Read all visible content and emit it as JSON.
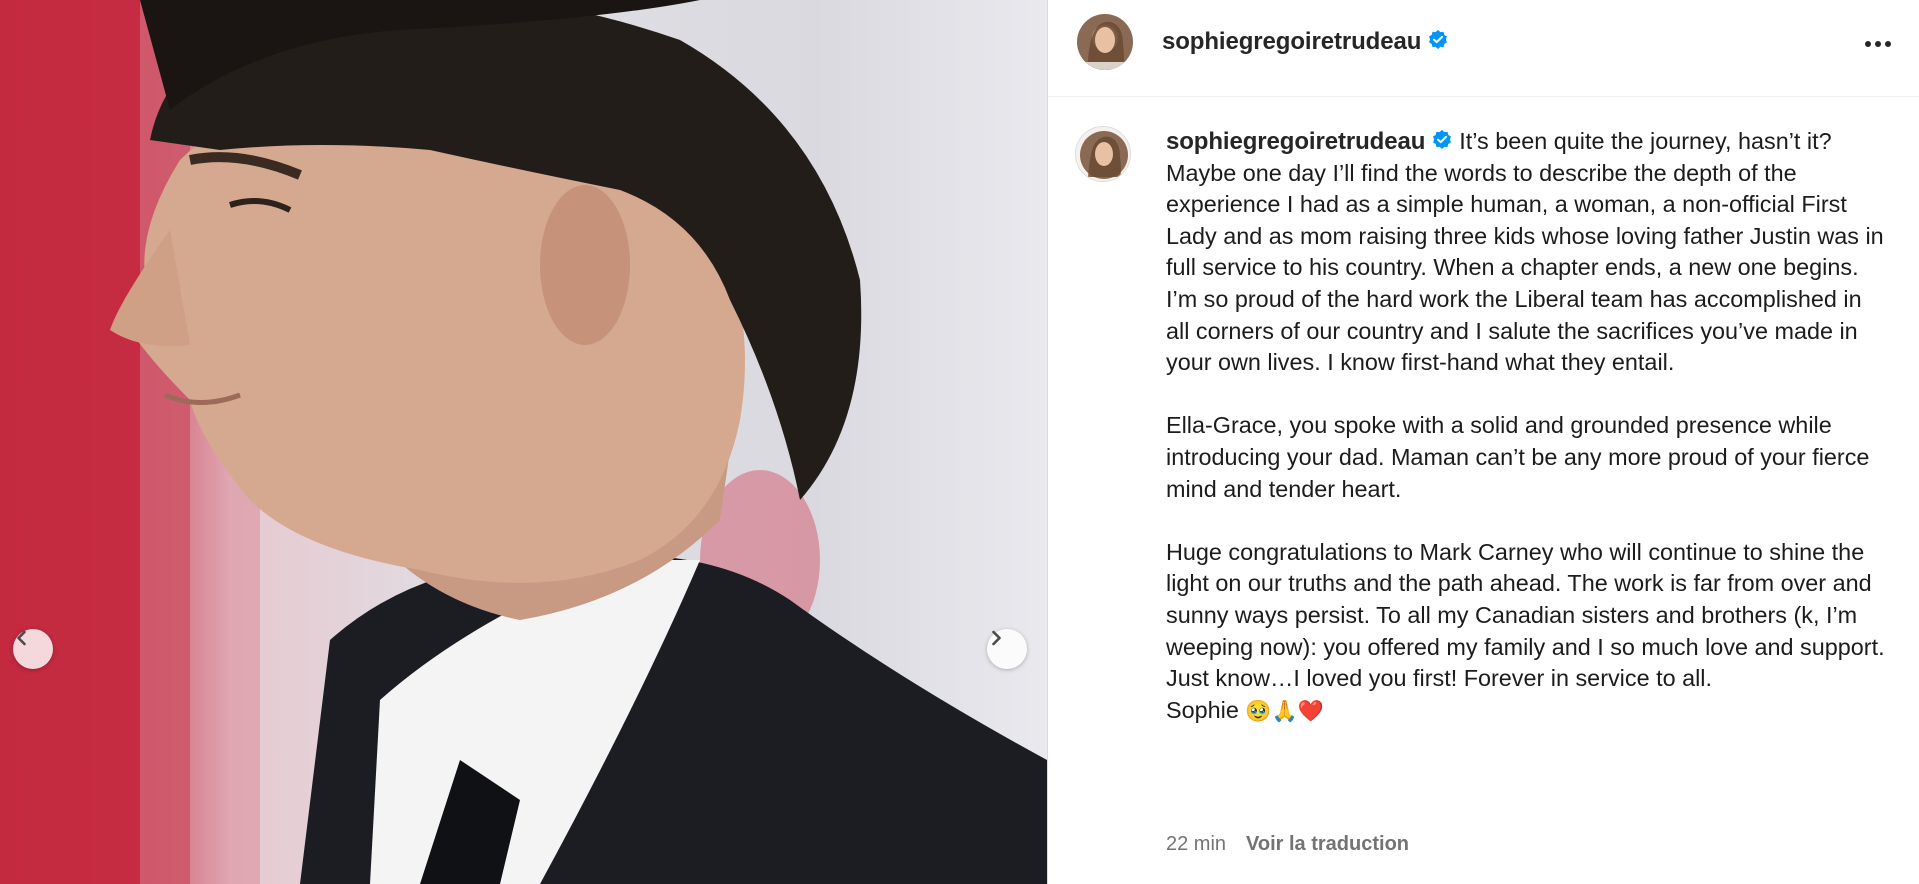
{
  "post": {
    "username": "sophiegregoiretrudeau",
    "verified": true,
    "caption": {
      "first_line": "It’s been quite the journey, hasn’t it?",
      "paragraph1": "Maybe one day I’ll find the words to describe the depth of the experience I had as a simple human, a woman, a non-official First Lady and as mom raising three kids whose loving father Justin was in full service to his country. When a chapter ends, a new one begins. I’m so proud of the hard work the Liberal team has accomplished in all corners of our country and I salute the sacrifices you’ve made in your own lives. I know first-hand what they entail.",
      "paragraph2": "Ella-Grace, you spoke with a solid and grounded presence while introducing your dad. Maman can’t be any more proud of your fierce mind and tender heart.",
      "paragraph3": "Huge congratulations to Mark Carney who will continue to shine the light on our truths and the path ahead. The work is far from over and sunny ways persist. To all my Canadian sisters and brothers (k, I’m weeping now): you offered my family and I so much love and support. Just know…I loved you first! Forever in service to all.",
      "signature": "Sophie",
      "signature_emoji": "🥹🙏❤️"
    },
    "timestamp": "22 min",
    "translate_label": "Voir la traduction"
  },
  "icons": {
    "verified": "verified-badge-icon",
    "more": "more-options-icon",
    "prev": "chevron-left-icon",
    "next": "chevron-right-icon"
  },
  "colors": {
    "verified_blue": "#0095f6",
    "meta_gray": "#737373",
    "flag_red": "#c8263e"
  }
}
